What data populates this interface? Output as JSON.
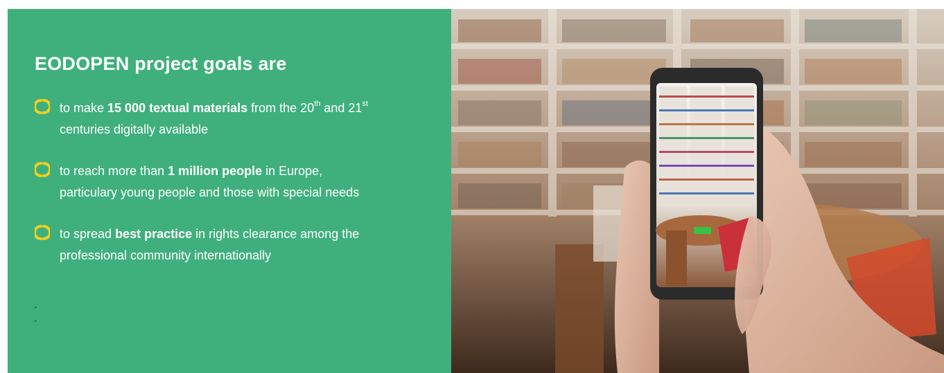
{
  "section": {
    "title": "EODOPEN project goals are",
    "goals": [
      {
        "icon": "yellow-bracket-icon",
        "pre": "to make ",
        "bold": "15 000 textual materials",
        "mid": " from the 20",
        "sup1": "th",
        "and": " and 21",
        "sup2": "st",
        "post": "centuries digitally available"
      },
      {
        "icon": "yellow-bracket-icon",
        "pre": "to reach more than ",
        "bold": "1 million people",
        "post1": " in Europe,",
        "post2": "particulary young people and those with special needs"
      },
      {
        "icon": "yellow-bracket-icon",
        "pre": "to spread ",
        "bold": "best practice",
        "post1": " in rights clearance among the",
        "post2": "professional community internationally"
      }
    ]
  },
  "photo": {
    "description_icon": "library-smartphone-photo"
  },
  "colors": {
    "panel": "#3fb07b",
    "accent": "#f2cf1d",
    "text": "#ffffff"
  }
}
